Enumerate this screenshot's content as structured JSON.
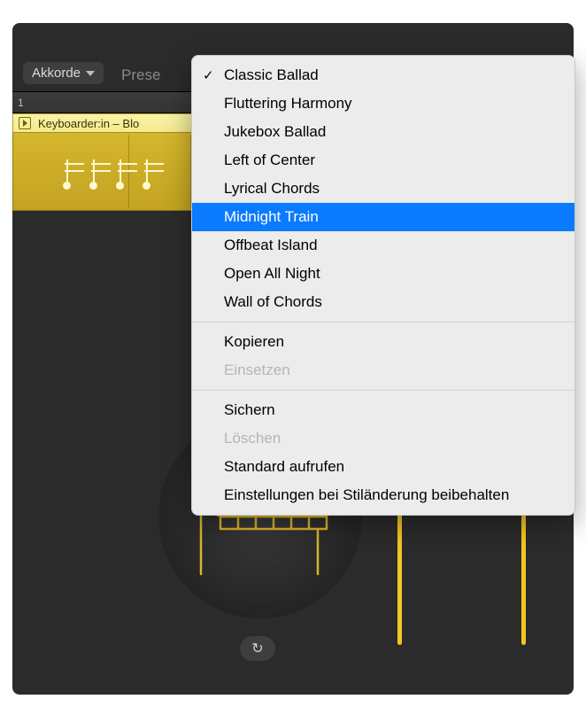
{
  "toolbar": {
    "akkorde_label": "Akkorde",
    "preset_label": "Prese"
  },
  "ruler": {
    "position": "1"
  },
  "region": {
    "title": "Keyboarder:in – Blo"
  },
  "menu": {
    "checked_index": 0,
    "highlight_index": 5,
    "presets": [
      "Classic Ballad",
      "Fluttering Harmony",
      "Jukebox Ballad",
      "Left of Center",
      "Lyrical Chords",
      "Midnight Train",
      "Offbeat Island",
      "Open All Night",
      "Wall of Chords"
    ],
    "actions": {
      "copy": "Kopieren",
      "paste": "Einsetzen",
      "save": "Sichern",
      "delete": "Löschen",
      "default": "Standard aufrufen",
      "keep": "Einstellungen bei Stiländerung beibehalten"
    }
  },
  "reset_icon": "↻"
}
